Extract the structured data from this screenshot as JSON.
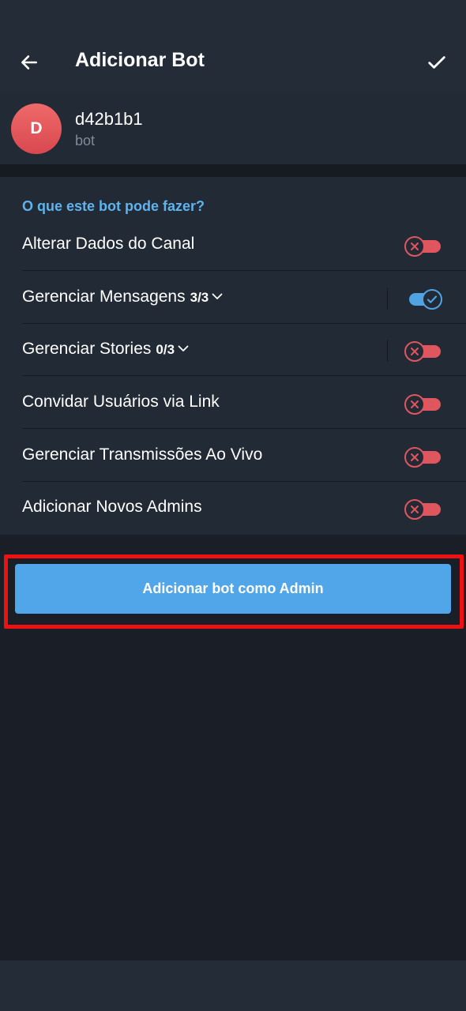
{
  "header": {
    "title": "Adicionar Bot",
    "back_icon": "arrow-left-icon",
    "confirm_icon": "check-icon"
  },
  "bot": {
    "avatar_letter": "D",
    "name": "d42b1b1",
    "subtitle": "bot"
  },
  "permissions": {
    "section_title": "O que este bot pode fazer?",
    "items": [
      {
        "label": "Alterar Dados do Canal",
        "count": "",
        "expandable": false,
        "enabled": false
      },
      {
        "label": "Gerenciar Mensagens",
        "count": "3/3",
        "expandable": true,
        "enabled": true
      },
      {
        "label": "Gerenciar Stories",
        "count": "0/3",
        "expandable": true,
        "enabled": false
      },
      {
        "label": "Convidar Usuários via Link",
        "count": "",
        "expandable": false,
        "enabled": false
      },
      {
        "label": "Gerenciar Transmissões Ao Vivo",
        "count": "",
        "expandable": false,
        "enabled": false
      },
      {
        "label": "Adicionar Novos Admins",
        "count": "",
        "expandable": false,
        "enabled": false
      }
    ]
  },
  "cta": {
    "label": "Adicionar bot como Admin"
  },
  "colors": {
    "accent": "#50a6e8",
    "toggle_off": "#e0565f",
    "highlight": "#ee1111"
  }
}
